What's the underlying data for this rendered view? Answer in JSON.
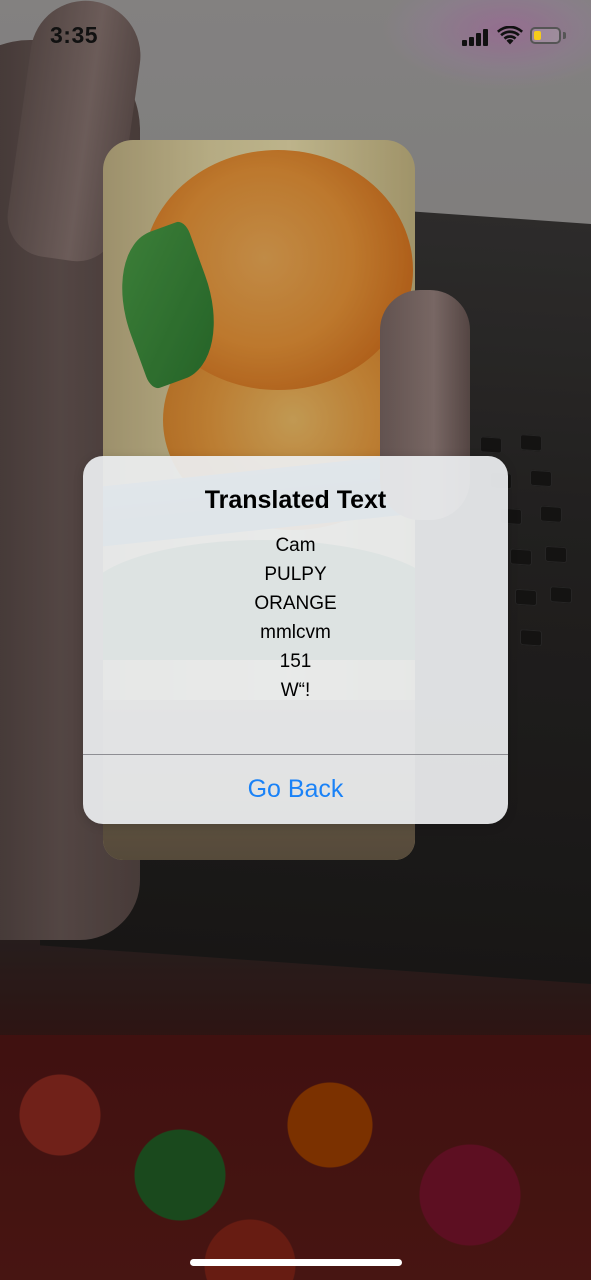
{
  "status_bar": {
    "time": "3:35",
    "icons": [
      "cellular-signal-icon",
      "wifi-icon",
      "battery-icon"
    ],
    "battery_color": "#f5cc1a"
  },
  "alert": {
    "title": "Translated Text",
    "lines": [
      "Cam",
      "PULPY",
      "ORANGE",
      "mmlcvm",
      "151",
      "W“!"
    ],
    "button_label": "Go Back",
    "button_color": "#1a82f7"
  },
  "background": {
    "description_icon": "camera-preview"
  }
}
